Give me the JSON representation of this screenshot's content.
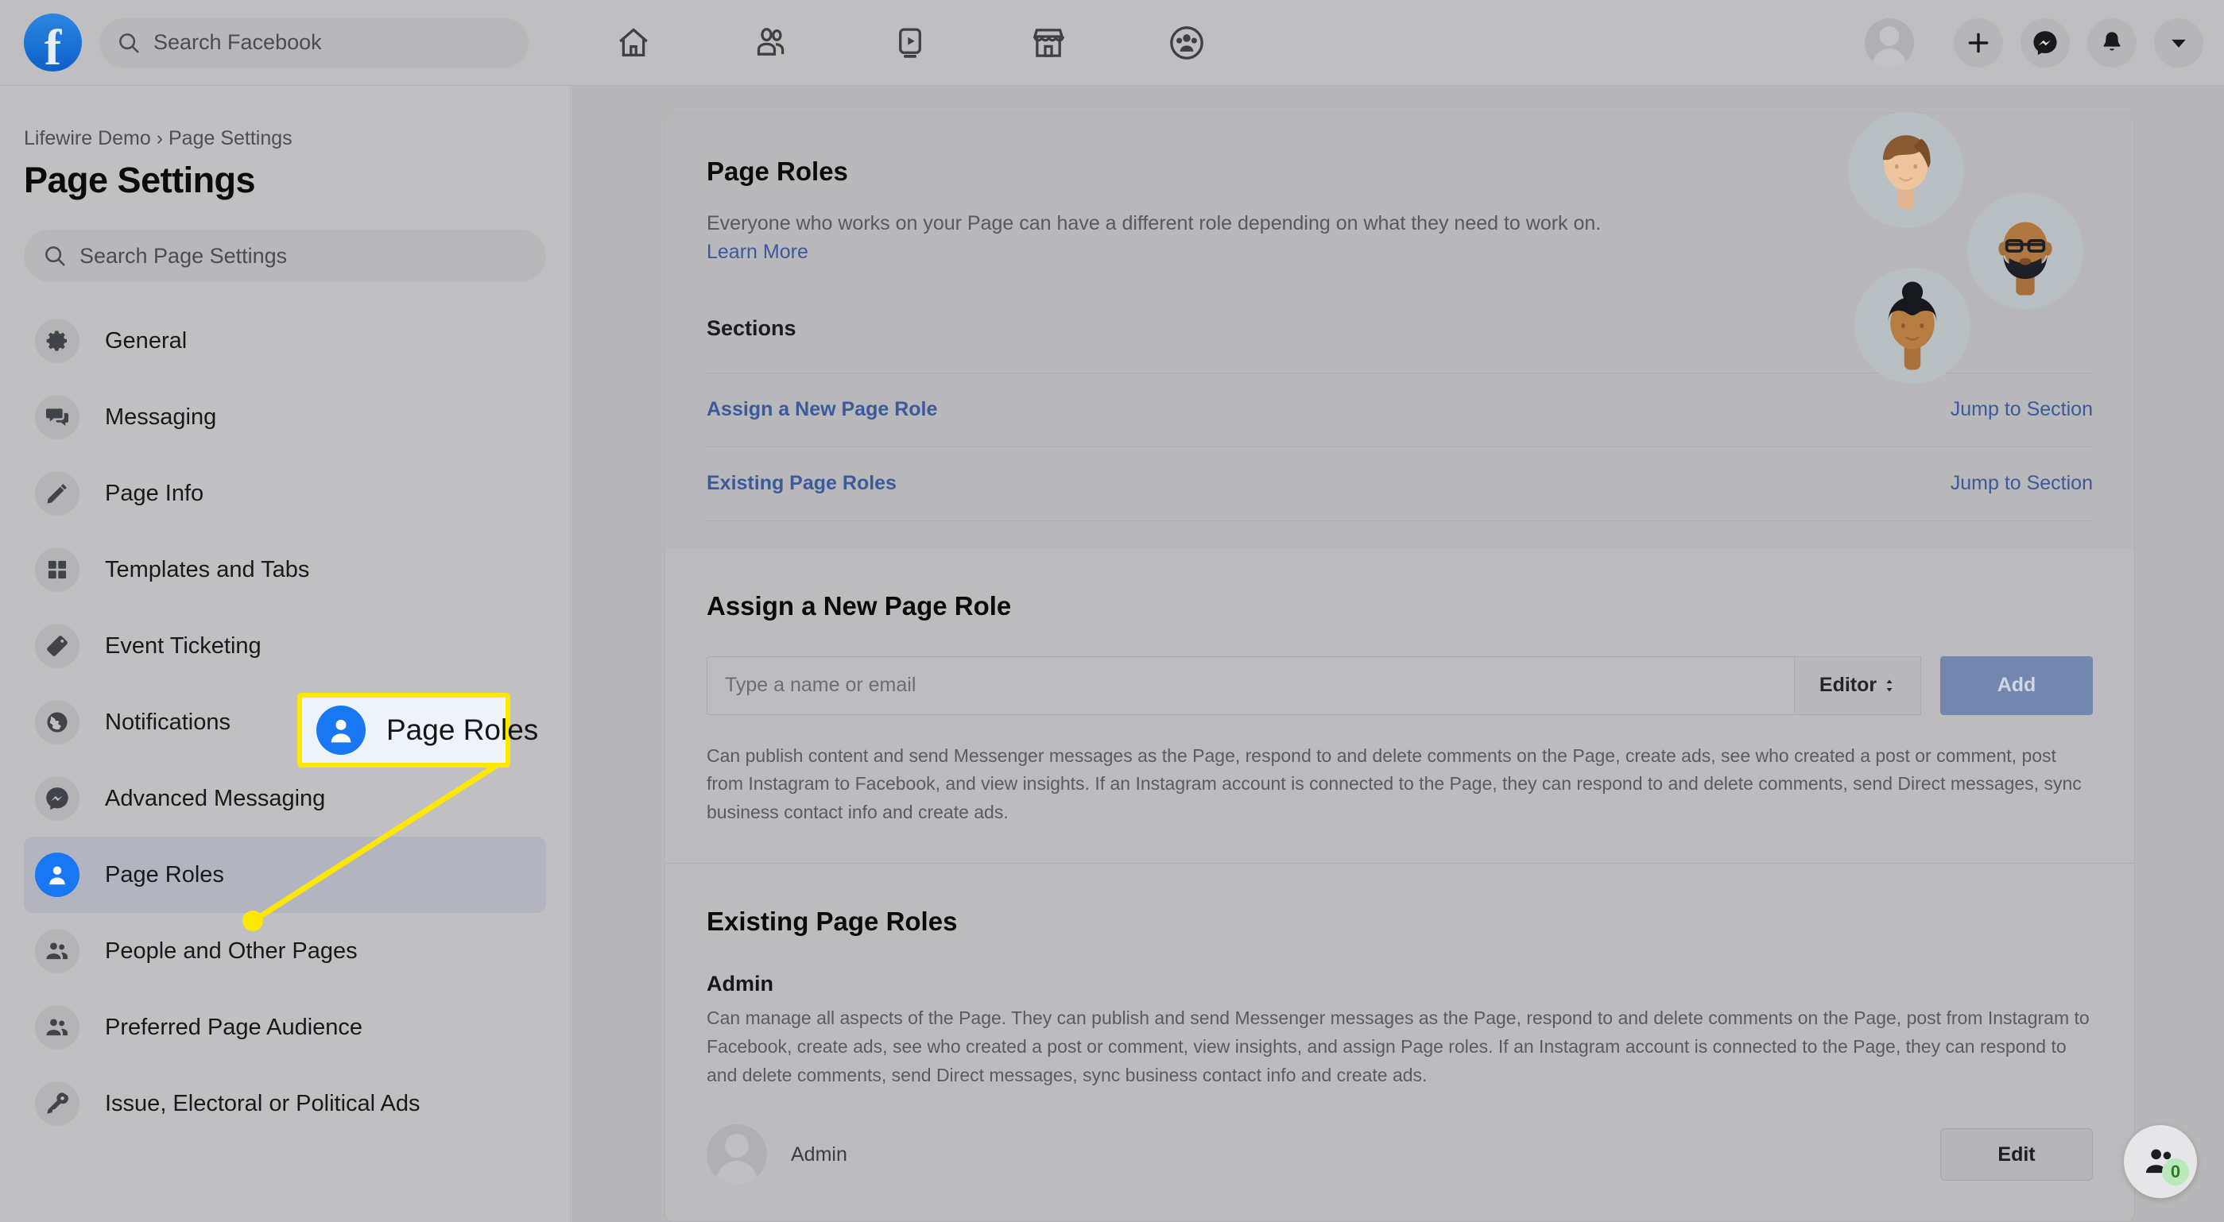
{
  "topbar": {
    "logo_icon": "facebook-logo",
    "search": {
      "placeholder": "Search Facebook",
      "icon": "search-icon"
    },
    "nav": [
      {
        "name": "home",
        "icon": "home-icon"
      },
      {
        "name": "friends",
        "icon": "friends-icon"
      },
      {
        "name": "watch",
        "icon": "watch-video-icon"
      },
      {
        "name": "marketplace",
        "icon": "marketplace-icon"
      },
      {
        "name": "groups",
        "icon": "groups-icon"
      }
    ],
    "right": [
      {
        "name": "profile-avatar",
        "icon": "avatar-icon"
      },
      {
        "name": "create",
        "icon": "plus-icon"
      },
      {
        "name": "messenger",
        "icon": "messenger-icon"
      },
      {
        "name": "notifications",
        "icon": "bell-icon"
      },
      {
        "name": "account-menu",
        "icon": "chevron-down-icon"
      }
    ]
  },
  "sidebar": {
    "breadcrumb": "Lifewire Demo › Page Settings",
    "title": "Page Settings",
    "search_placeholder": "Search Page Settings",
    "items": [
      {
        "label": "General",
        "icon": "gear-icon",
        "active": false
      },
      {
        "label": "Messaging",
        "icon": "chat-bubbles-icon",
        "active": false
      },
      {
        "label": "Page Info",
        "icon": "pencil-icon",
        "active": false
      },
      {
        "label": "Templates and Tabs",
        "icon": "grid-icon",
        "active": false
      },
      {
        "label": "Event Ticketing",
        "icon": "ticket-icon",
        "active": false
      },
      {
        "label": "Notifications",
        "icon": "globe-icon",
        "active": false
      },
      {
        "label": "Advanced Messaging",
        "icon": "messenger-icon",
        "active": false
      },
      {
        "label": "Page Roles",
        "icon": "person-icon",
        "active": true
      },
      {
        "label": "People and Other Pages",
        "icon": "people-icon",
        "active": false
      },
      {
        "label": "Preferred Page Audience",
        "icon": "people-icon",
        "active": false
      },
      {
        "label": "Issue, Electoral or Political Ads",
        "icon": "key-icon",
        "active": false
      }
    ]
  },
  "main": {
    "header": {
      "title": "Page Roles",
      "description": "Everyone who works on your Page can have a different role depending on what they need to work on.",
      "learn_more": "Learn More"
    },
    "sections_label": "Sections",
    "sections": [
      {
        "name": "Assign a New Page Role",
        "jump": "Jump to Section"
      },
      {
        "name": "Existing Page Roles",
        "jump": "Jump to Section"
      }
    ],
    "assign": {
      "title": "Assign a New Page Role",
      "input_placeholder": "Type a name or email",
      "input_value": "",
      "role_selected": "Editor",
      "add_label": "Add",
      "role_description": "Can publish content and send Messenger messages as the Page, respond to and delete comments on the Page, create ads, see who created a post or comment, post from Instagram to Facebook, and view insights. If an Instagram account is connected to the Page, they can respond to and delete comments, send Direct messages, sync business contact info and create ads."
    },
    "existing": {
      "title": "Existing Page Roles",
      "role_name": "Admin",
      "role_description": "Can manage all aspects of the Page. They can publish and send Messenger messages as the Page, respond to and delete comments on the Page, post from Instagram to Facebook, create ads, see who created a post or comment, view insights, and assign Page roles. If an Instagram account is connected to the Page, they can respond to and delete comments, send Direct messages, sync business contact info and create ads.",
      "member_name": "Admin",
      "edit_label": "Edit"
    }
  },
  "callout": {
    "label": "Page Roles",
    "icon": "person-icon",
    "border_color": "#ffe800",
    "background_color": "#eef3fa",
    "accent_color": "#1877f2"
  },
  "fab": {
    "icon": "contacts-icon",
    "badge_count": "0",
    "badge_color": "#b9e8b9"
  },
  "colors": {
    "link": "#3b5a9b",
    "facebook_blue": "#1877f2",
    "add_button": "#7286ae",
    "page_background": "#c4c4c6"
  }
}
